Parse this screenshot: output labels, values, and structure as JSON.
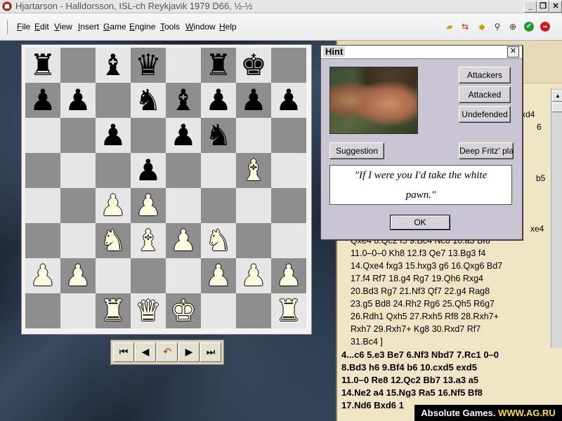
{
  "window": {
    "title": "Hjartarson - Halldorsson, ISL-ch Reykjavik 1979  D66, ½-½",
    "controls": [
      "_",
      "❐",
      "✕"
    ]
  },
  "menu": [
    "File",
    "Edit",
    "View",
    "Insert",
    "Game",
    "Engine",
    "Tools",
    "Window",
    "Help"
  ],
  "toolbar_icons": [
    "folder-icon",
    "arrows-icon",
    "warning-icon",
    "binoculars-icon",
    "zoom-icon",
    "green-check-icon",
    "red-stop-icon"
  ],
  "board": {
    "light_color": "#e6e6e6",
    "dark_color": "#8e8e8e",
    "rows": [
      [
        "r",
        "",
        "b",
        "q",
        "",
        "r",
        "k",
        ""
      ],
      [
        "p",
        "p",
        "",
        "n",
        "b",
        "p",
        "p",
        "p"
      ],
      [
        "",
        "",
        "p",
        "",
        "p",
        "n",
        "",
        ""
      ],
      [
        "",
        "",
        "",
        "p",
        "",
        "",
        "B",
        ""
      ],
      [
        "",
        "",
        "P",
        "P",
        "",
        "",
        "",
        ""
      ],
      [
        "",
        "",
        "N",
        "B",
        "P",
        "N",
        "",
        ""
      ],
      [
        "P",
        "P",
        "",
        "",
        "",
        "P",
        "P",
        "P"
      ],
      [
        "",
        "",
        "R",
        "Q",
        "K",
        "",
        "",
        "R"
      ]
    ]
  },
  "nav_buttons": [
    "⏮",
    "◀",
    "↶",
    "▶",
    "⏭"
  ],
  "dialog": {
    "title": "Hint",
    "close": "✕",
    "buttons": {
      "attackers": "Attackers",
      "attacked": "Attacked",
      "undefended": "Undefended",
      "suggestion": "Suggestion",
      "deep_fritz": "Deep Fritz' plan"
    },
    "quote_line1": "\"If I were you I'd take the white",
    "quote_line2": "pawn.\"",
    "ok": "OK"
  },
  "notation": {
    "peek": [
      "xd4",
      "6",
      "b5",
      "xe4"
    ],
    "variation": [
      "Qxe4  8.Qc2  f5  9.Bc4  Nc6  10.a3  Bf6",
      "11.0–0–0  Kh8  12.f3  Qe7  13.Bg3  f4",
      "14.Qxe4  fxg3  15.hxg3  g6  16.Qxg6  Bd7",
      "17.f4  Rf7  18.g4  Rg7  19.Qh6  Rxg4",
      "20.Bd3  Rg7  21.Nf3  Qf7  22.g4  Rag8",
      "23.g5  Bd8  24.Rh2  Rg6  25.Qh5  R6g7",
      "26.Rdh1  Qxh5  27.Rxh5  Rf8  28.Rxh7+",
      "Rxh7  29.Rxh7+  Kg8  30.Rxd7  Rf7",
      "31.Bc4 ]"
    ],
    "main": [
      "4...c6  5.e3  Be7  6.Nf3  Nbd7  7.Rc1  0–0",
      "8.Bd3  h6  9.Bf4  b6  10.cxd5  exd5",
      "11.0–0  Re8  12.Qc2  Bb7  13.a3  a5",
      "14.Ne2  a4  15.Ng3  Ra5  16.Nf5  Bf8",
      "17.Nd6  Bxd6  1"
    ]
  },
  "watermark": {
    "label": "Absolute Games. ",
    "url": "WWW.AG.RU"
  }
}
